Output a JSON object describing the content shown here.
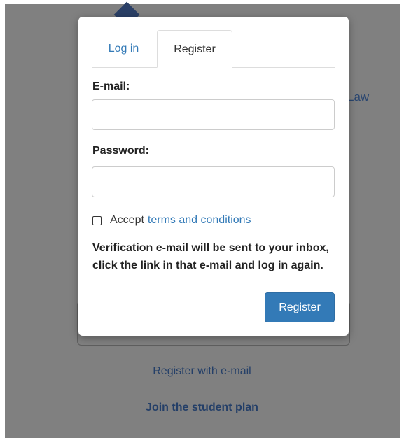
{
  "background": {
    "title_fragment": "Law",
    "register_email_link": "Register with e-mail",
    "student_plan_link": "Join the student plan"
  },
  "modal": {
    "tabs": [
      {
        "label": "Log in",
        "active": false
      },
      {
        "label": "Register",
        "active": true
      }
    ],
    "email_label": "E-mail:",
    "email_value": "",
    "password_label": "Password:",
    "password_value": "",
    "accept_checked": false,
    "accept_text": "Accept",
    "terms_link": "terms and conditions",
    "verification_note": "Verification e-mail will be sent to your inbox, click the link in that e-mail and log in again.",
    "submit_label": "Register"
  },
  "colors": {
    "accent": "#337ab7",
    "overlay": "#808080",
    "background_link": "#243f68"
  },
  "icons": {
    "logo": "diamond-logo-icon"
  }
}
